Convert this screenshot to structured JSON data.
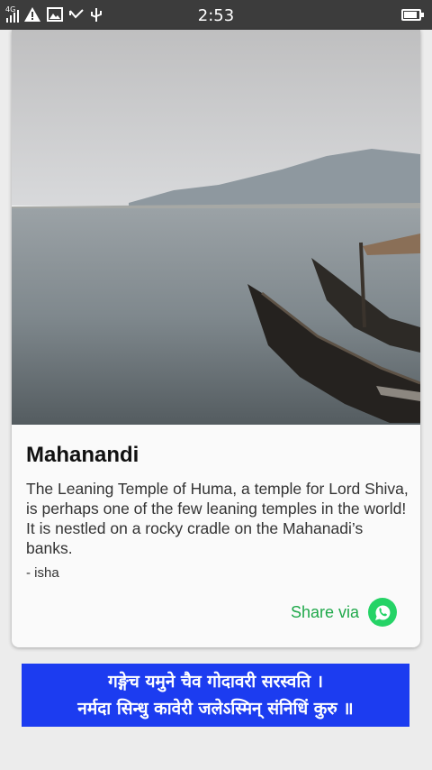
{
  "status_bar": {
    "network": "4G",
    "time": "2:53"
  },
  "card": {
    "title": "Mahanandi",
    "description": "The Leaning Temple of Huma, a temple for Lord Shiva, is perhaps one of the few leaning temples in the world! It is nestled on a rocky cradle on the Mahanadi’s banks.",
    "author": "- isha",
    "share_label": "Share via"
  },
  "banner": {
    "line1": "गङ्गेच यमुने चैव गोदावरी सरस्वति ।",
    "line2": "नर्मदा सिन्धु कावेरी जलेऽस्मिन् संनिधिं कुरु ॥"
  },
  "colors": {
    "status_bar": "#3c3c3c",
    "share_accent": "#1fa84a",
    "whatsapp": "#25d366",
    "banner_bg": "#1c3cf0"
  }
}
